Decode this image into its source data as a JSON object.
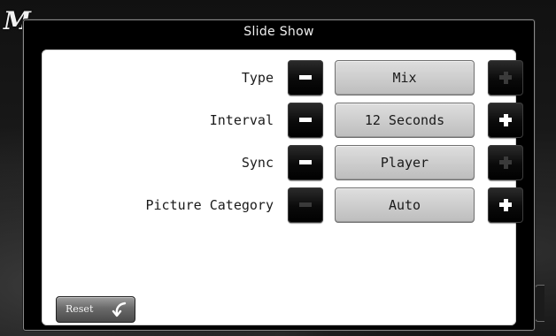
{
  "dialog": {
    "title": "Slide Show"
  },
  "corner_logo": {
    "glyph": "M"
  },
  "settings": [
    {
      "label": "Type",
      "value": "Mix",
      "minus_enabled": true,
      "plus_enabled": false
    },
    {
      "label": "Interval",
      "value": "12 Seconds",
      "minus_enabled": true,
      "plus_enabled": true
    },
    {
      "label": "Sync",
      "value": "Player",
      "minus_enabled": true,
      "plus_enabled": false
    },
    {
      "label": "Picture Category",
      "value": "Auto",
      "minus_enabled": false,
      "plus_enabled": true
    }
  ],
  "reset": {
    "label": "Reset",
    "icon": "undo-arrow-icon"
  },
  "colors": {
    "panel_background": "#ffffff",
    "button_dark": "#000000",
    "value_box": "#cccccc",
    "disabled_glyph": "#3a3a3a"
  }
}
